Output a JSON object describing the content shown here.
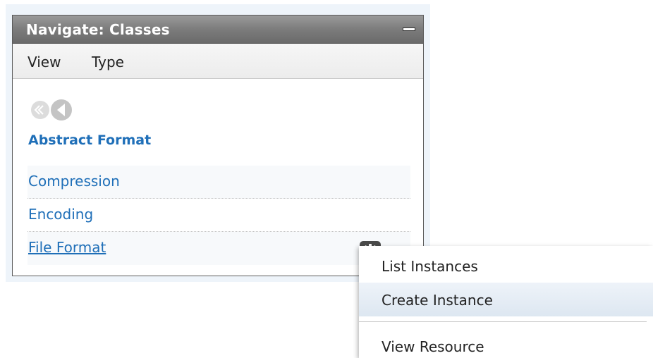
{
  "panel": {
    "title": "Navigate: Classes",
    "minimize_icon": "minimize-icon"
  },
  "menu": {
    "view_label": "View",
    "type_label": "Type"
  },
  "navigation": {
    "back_icon": "back-arrows-icon"
  },
  "class": {
    "name": "Abstract Format"
  },
  "subclasses": [
    {
      "label": "Compression"
    },
    {
      "label": "Encoding"
    },
    {
      "label": "File Format"
    }
  ],
  "row_actions": {
    "gear_icon": "gear-icon"
  },
  "context_menu": {
    "items": [
      {
        "label": "List Instances"
      },
      {
        "label": "Create Instance",
        "highlighted": true
      },
      {
        "label": "View Resource"
      }
    ]
  },
  "colors": {
    "link": "#1f6fb8",
    "title_bar": "#7c7c7c",
    "highlight": "#dde7f1"
  }
}
